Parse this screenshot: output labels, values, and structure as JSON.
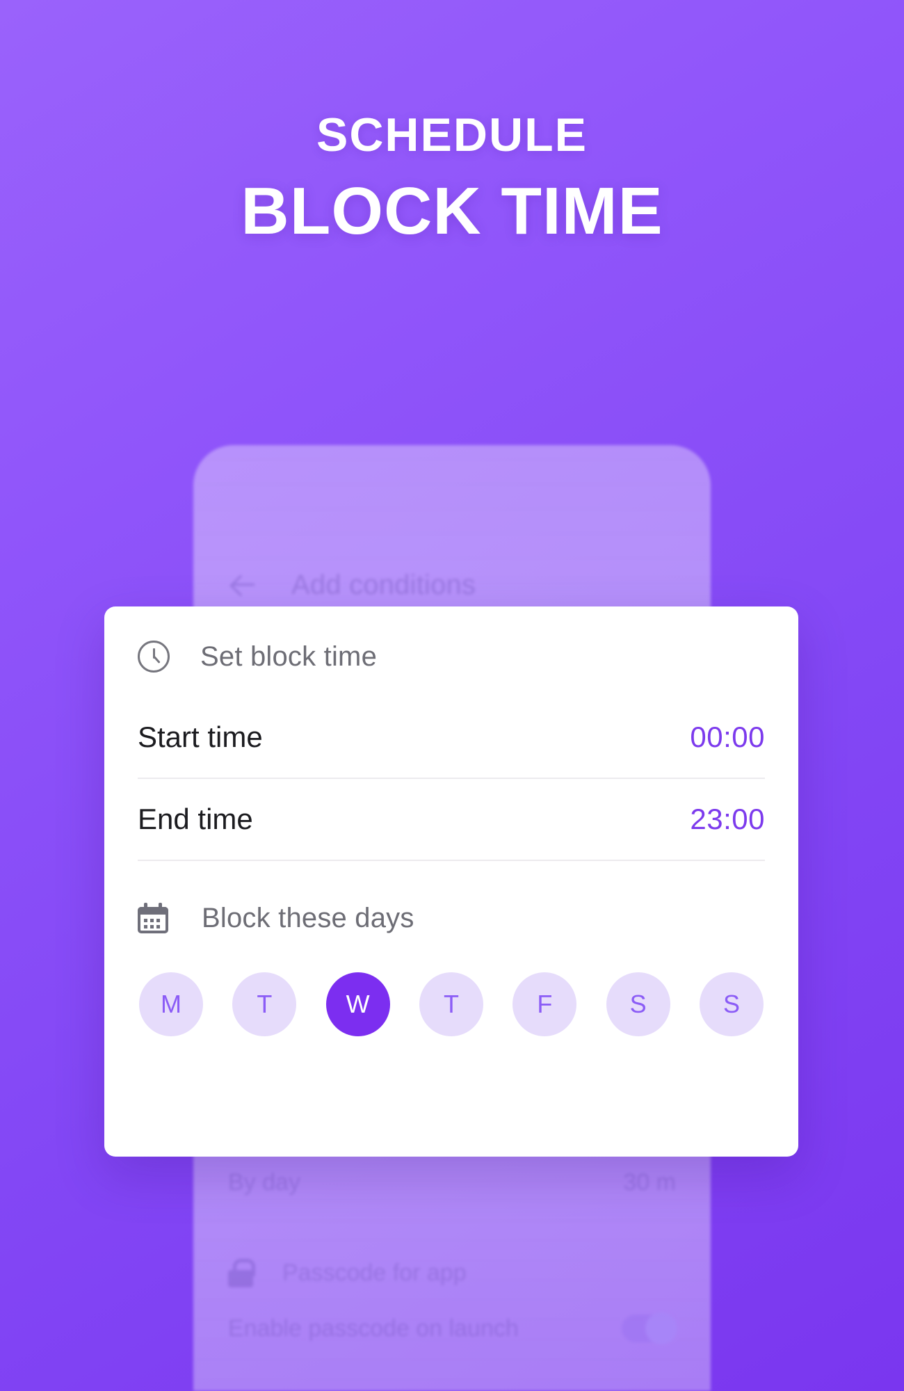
{
  "headline": {
    "line1": "SCHEDULE",
    "line2": "BLOCK TIME"
  },
  "colors": {
    "background_top": "#9a62fb",
    "background_bottom": "#7a36ef",
    "accent": "#7c3aed",
    "day_chip_bg": "#e6dcfb",
    "day_chip_selected_bg": "#7c2ef0",
    "card_bg": "#ffffff"
  },
  "background_screen": {
    "appbar": {
      "back_icon": "arrow-left-icon",
      "title": "Add conditions"
    },
    "rows": [
      {
        "label": "By day",
        "value": "30 m"
      },
      {
        "label": "Passcode for app",
        "icon": "lock-icon"
      },
      {
        "label": "Enable passcode on launch",
        "toggle": "on"
      }
    ]
  },
  "dialog": {
    "header": {
      "icon": "clock-icon",
      "title": "Set block time"
    },
    "time_rows": [
      {
        "label": "Start time",
        "value": "00:00"
      },
      {
        "label": "End time",
        "value": "23:00"
      }
    ],
    "days_section": {
      "icon": "calendar-icon",
      "title": "Block these days",
      "days": [
        {
          "label": "M",
          "selected": false
        },
        {
          "label": "T",
          "selected": false
        },
        {
          "label": "W",
          "selected": true
        },
        {
          "label": "T",
          "selected": false
        },
        {
          "label": "F",
          "selected": false
        },
        {
          "label": "S",
          "selected": false
        },
        {
          "label": "S",
          "selected": false
        }
      ]
    }
  }
}
